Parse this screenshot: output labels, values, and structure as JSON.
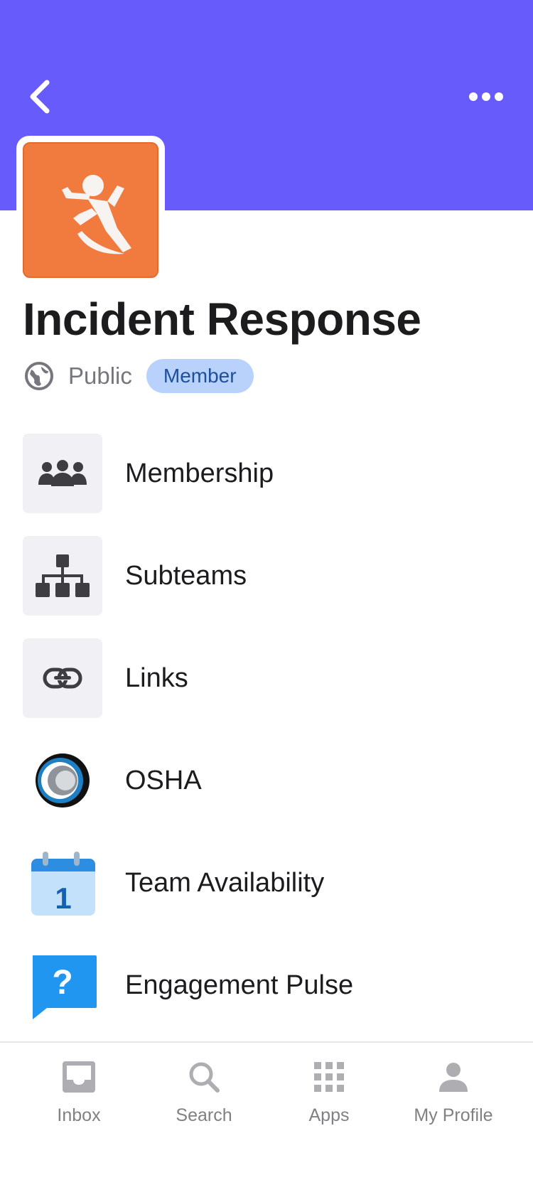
{
  "header": {
    "bg_color": "#675cfb",
    "back_icon": "chevron-left-icon",
    "more_icon": "ellipsis-icon"
  },
  "team": {
    "title": "Incident Response",
    "avatar_icon": "person-falling-icon",
    "avatar_color": "#f17b3f",
    "privacy": "Public",
    "privacy_icon": "globe-icon",
    "role_badge": "Member"
  },
  "items": [
    {
      "label": "Membership",
      "icon": "group-icon"
    },
    {
      "label": "Subteams",
      "icon": "hierarchy-icon"
    },
    {
      "label": "Links",
      "icon": "link-icon"
    },
    {
      "label": "OSHA",
      "icon": "osha-logo-icon"
    },
    {
      "label": "Team Availability",
      "icon": "calendar-icon"
    },
    {
      "label": "Engagement Pulse",
      "icon": "question-bubble-icon"
    }
  ],
  "tabbar": {
    "tabs": [
      {
        "label": "Inbox",
        "icon": "inbox-icon"
      },
      {
        "label": "Search",
        "icon": "search-icon"
      },
      {
        "label": "Apps",
        "icon": "grid-icon"
      },
      {
        "label": "My Profile",
        "icon": "person-icon"
      }
    ]
  }
}
